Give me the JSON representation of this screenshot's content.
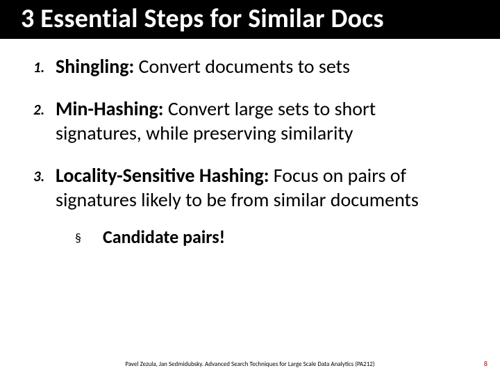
{
  "title": "3 Essential Steps for Similar Docs",
  "steps": [
    {
      "num": "1.",
      "term": "Shingling:",
      "desc": " Convert documents to sets"
    },
    {
      "num": "2.",
      "term": "Min-Hashing:",
      "desc": " Convert large sets to short signatures, while preserving similarity"
    },
    {
      "num": "3.",
      "term": "Locality-Sensitive Hashing:",
      "desc": " Focus on pairs of signatures likely to be from similar documents"
    }
  ],
  "sub": {
    "mark": "§",
    "text": "Candidate pairs!"
  },
  "footer": "Pavel Zezula, Jan Sedmidubsky. Advanced Search Techniques for Large Scale Data Analytics (PA212)",
  "page": "8"
}
